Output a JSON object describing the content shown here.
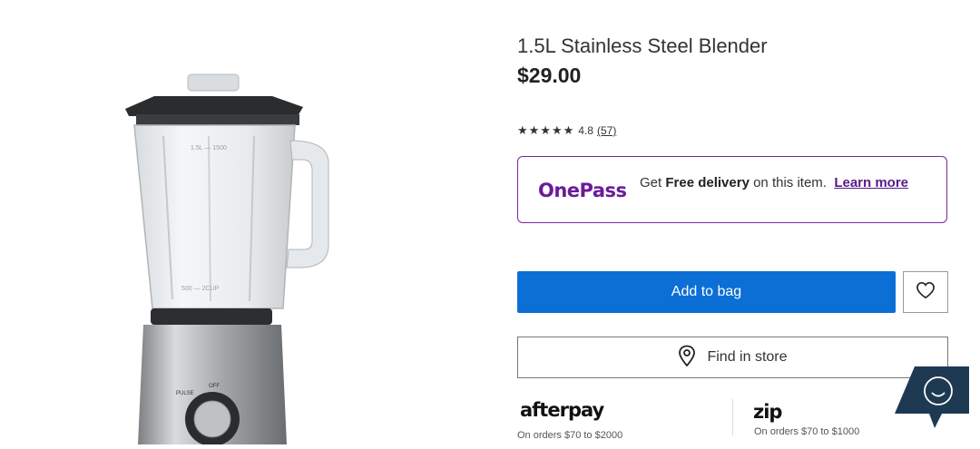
{
  "product": {
    "title": "1.5L Stainless Steel Blender",
    "price": "$29.00",
    "rating": {
      "stars": "★★★★★",
      "score": "4.8",
      "count": "(57)"
    }
  },
  "onepass": {
    "logo": "OnePass",
    "text_pre": "Get ",
    "text_bold": "Free delivery",
    "text_post": " on this item.",
    "learn_more": "Learn more"
  },
  "actions": {
    "add_to_bag": "Add to bag",
    "wishlist_icon": "heart-icon",
    "find_in_store": "Find in store",
    "store_icon": "location-pin-icon"
  },
  "payments": {
    "afterpay_logo": "afterpay",
    "afterpay_sub": "On orders $70 to $2000",
    "zip_logo": "zip",
    "zip_sub": "On orders $70 to $1000"
  },
  "chat": {
    "icon": "chat-smile-icon"
  },
  "colors": {
    "primary": "#0b6fd6",
    "onepass": "#7a27a0"
  }
}
